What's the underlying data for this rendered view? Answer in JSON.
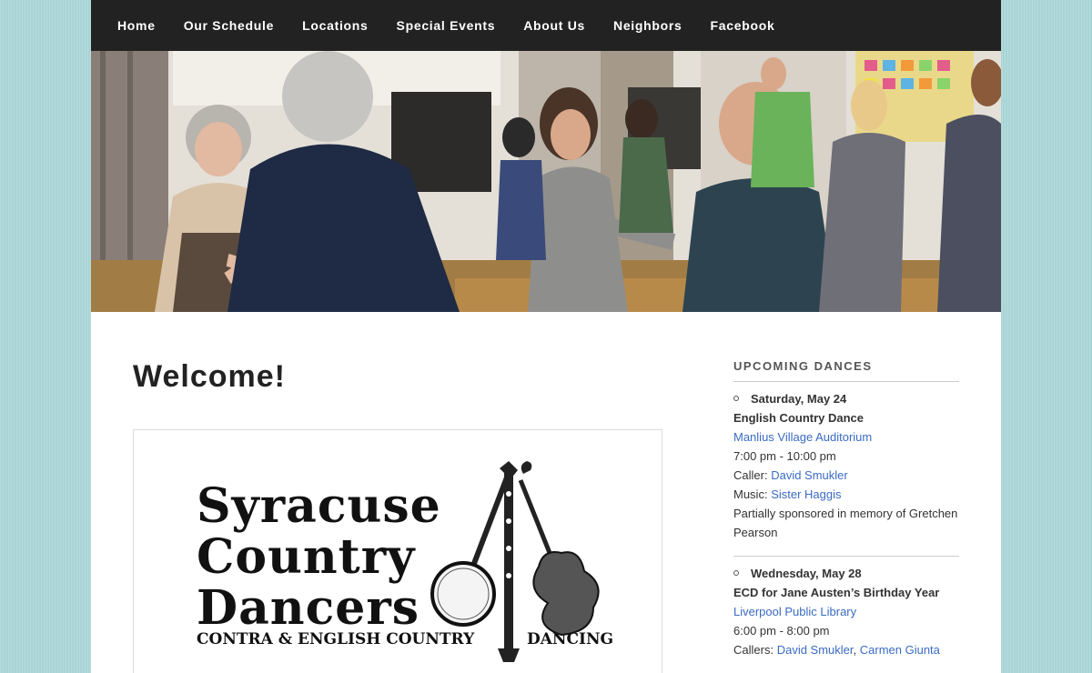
{
  "nav": {
    "items": [
      "Home",
      "Our Schedule",
      "Locations",
      "Special Events",
      "About Us",
      "Neighbors",
      "Facebook"
    ]
  },
  "main": {
    "title": "Welcome!",
    "logo": {
      "line1": "Syracuse",
      "line2": "Country",
      "line3": "Dancers",
      "tagline_left": "CONTRA & ENGLISH COUNTRY",
      "tagline_right": "DANCING"
    }
  },
  "sidebar": {
    "widget_title": "UPCOMING DANCES",
    "events": [
      {
        "date": "Saturday, May 24",
        "name": "English Country Dance",
        "location": "Manlius Village Auditorium",
        "time": "7:00 pm - 10:00 pm",
        "caller_label": "Caller:",
        "callers": [
          "David Smukler"
        ],
        "music_label": "Music:",
        "music": "Sister Haggis",
        "note": "Partially sponsored in memory of Gretchen Pearson"
      },
      {
        "date": "Wednesday, May 28",
        "name": "ECD for Jane Austen’s Birthday Year",
        "location": "Liverpool Public Library",
        "time": "6:00 pm - 8:00 pm",
        "caller_label": "Callers:",
        "callers": [
          "David Smukler",
          "Carmen Giunta"
        ]
      }
    ]
  },
  "colors": {
    "nav_bg": "#222222",
    "link": "#3b6bc4",
    "page_bg": "#a8d4d6"
  }
}
